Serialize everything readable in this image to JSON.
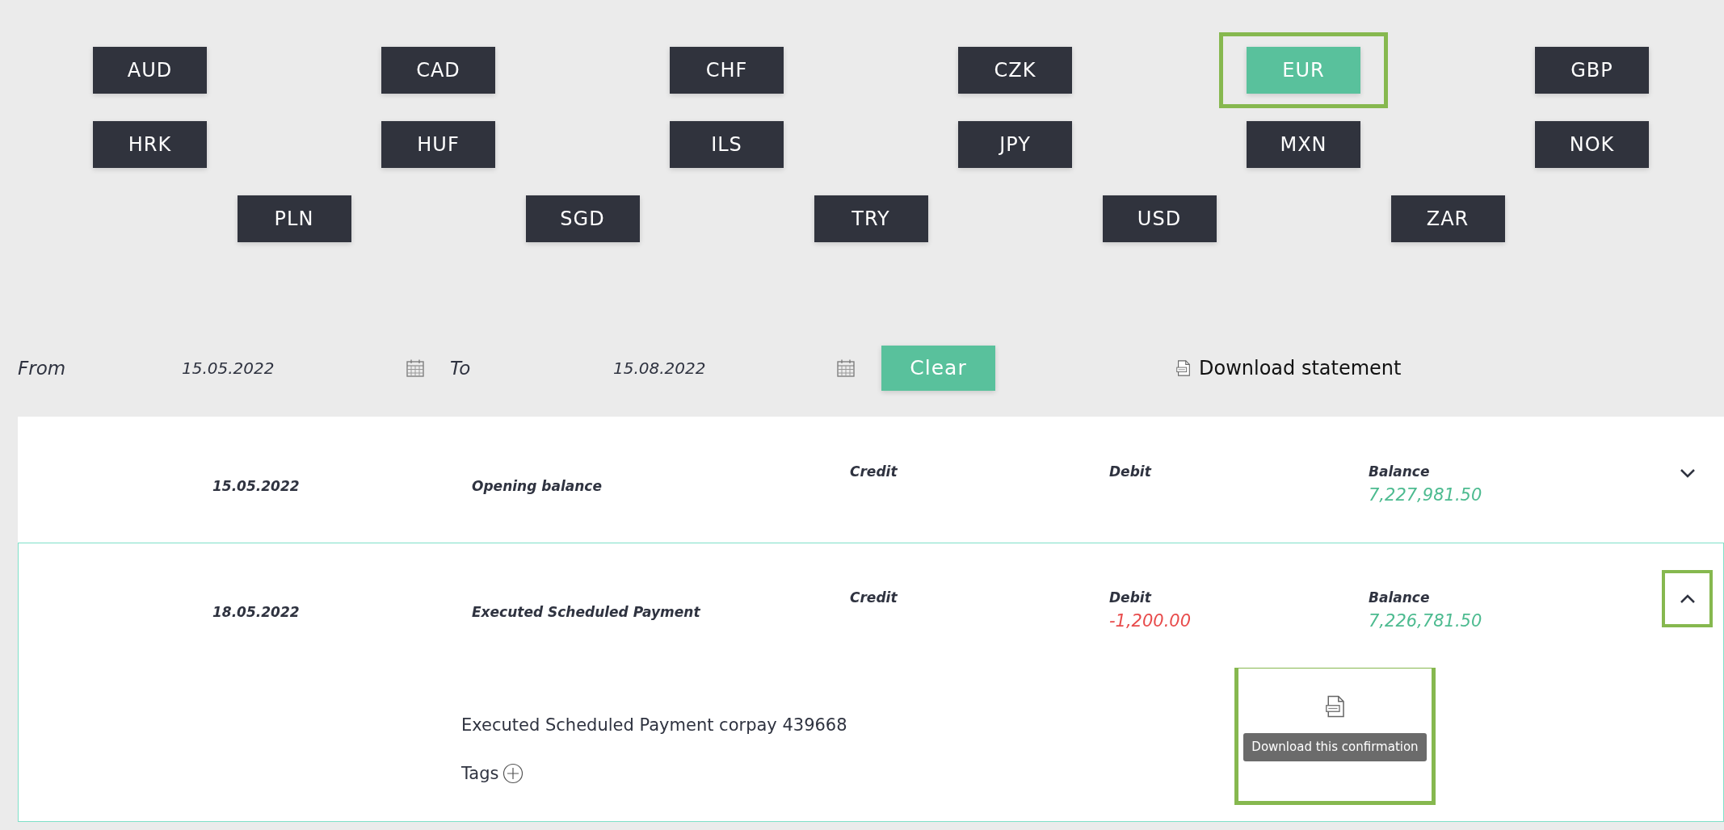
{
  "currency_rows": [
    [
      {
        "code": "AUD",
        "selected": false,
        "highlighted": false
      },
      {
        "code": "CAD",
        "selected": false,
        "highlighted": false
      },
      {
        "code": "CHF",
        "selected": false,
        "highlighted": false
      },
      {
        "code": "CZK",
        "selected": false,
        "highlighted": false
      },
      {
        "code": "EUR",
        "selected": true,
        "highlighted": true
      },
      {
        "code": "GBP",
        "selected": false,
        "highlighted": false
      }
    ],
    [
      {
        "code": "HRK",
        "selected": false,
        "highlighted": false
      },
      {
        "code": "HUF",
        "selected": false,
        "highlighted": false
      },
      {
        "code": "ILS",
        "selected": false,
        "highlighted": false
      },
      {
        "code": "JPY",
        "selected": false,
        "highlighted": false
      },
      {
        "code": "MXN",
        "selected": false,
        "highlighted": false
      },
      {
        "code": "NOK",
        "selected": false,
        "highlighted": false
      }
    ],
    [
      {
        "code": "PLN",
        "selected": false,
        "highlighted": false
      },
      {
        "code": "SGD",
        "selected": false,
        "highlighted": false
      },
      {
        "code": "TRY",
        "selected": false,
        "highlighted": false
      },
      {
        "code": "USD",
        "selected": false,
        "highlighted": false
      },
      {
        "code": "ZAR",
        "selected": false,
        "highlighted": false
      }
    ]
  ],
  "filter": {
    "from_label": "From",
    "from_date": "15.05.2022",
    "to_label": "To",
    "to_date": "15.08.2022",
    "clear_button": "Clear",
    "download_statement": "Download statement"
  },
  "transactions": [
    {
      "date": "15.05.2022",
      "description": "Opening balance",
      "credit_label": "Credit",
      "debit_label": "Debit",
      "balance_label": "Balance",
      "balance": "7,227,981.50",
      "expanded": false,
      "toggle_highlighted": false
    },
    {
      "date": "18.05.2022",
      "description": "Executed Scheduled Payment",
      "credit_label": "Credit",
      "debit_label": "Debit",
      "debit": "-1,200.00",
      "balance_label": "Balance",
      "balance": "7,226,781.50",
      "expanded": true,
      "toggle_highlighted": true,
      "details": {
        "text": "Executed Scheduled Payment corpay 439668",
        "tags_label": "Tags",
        "confirmation_tooltip": "Download this confirmation",
        "confirmation_highlighted": true
      }
    }
  ]
}
